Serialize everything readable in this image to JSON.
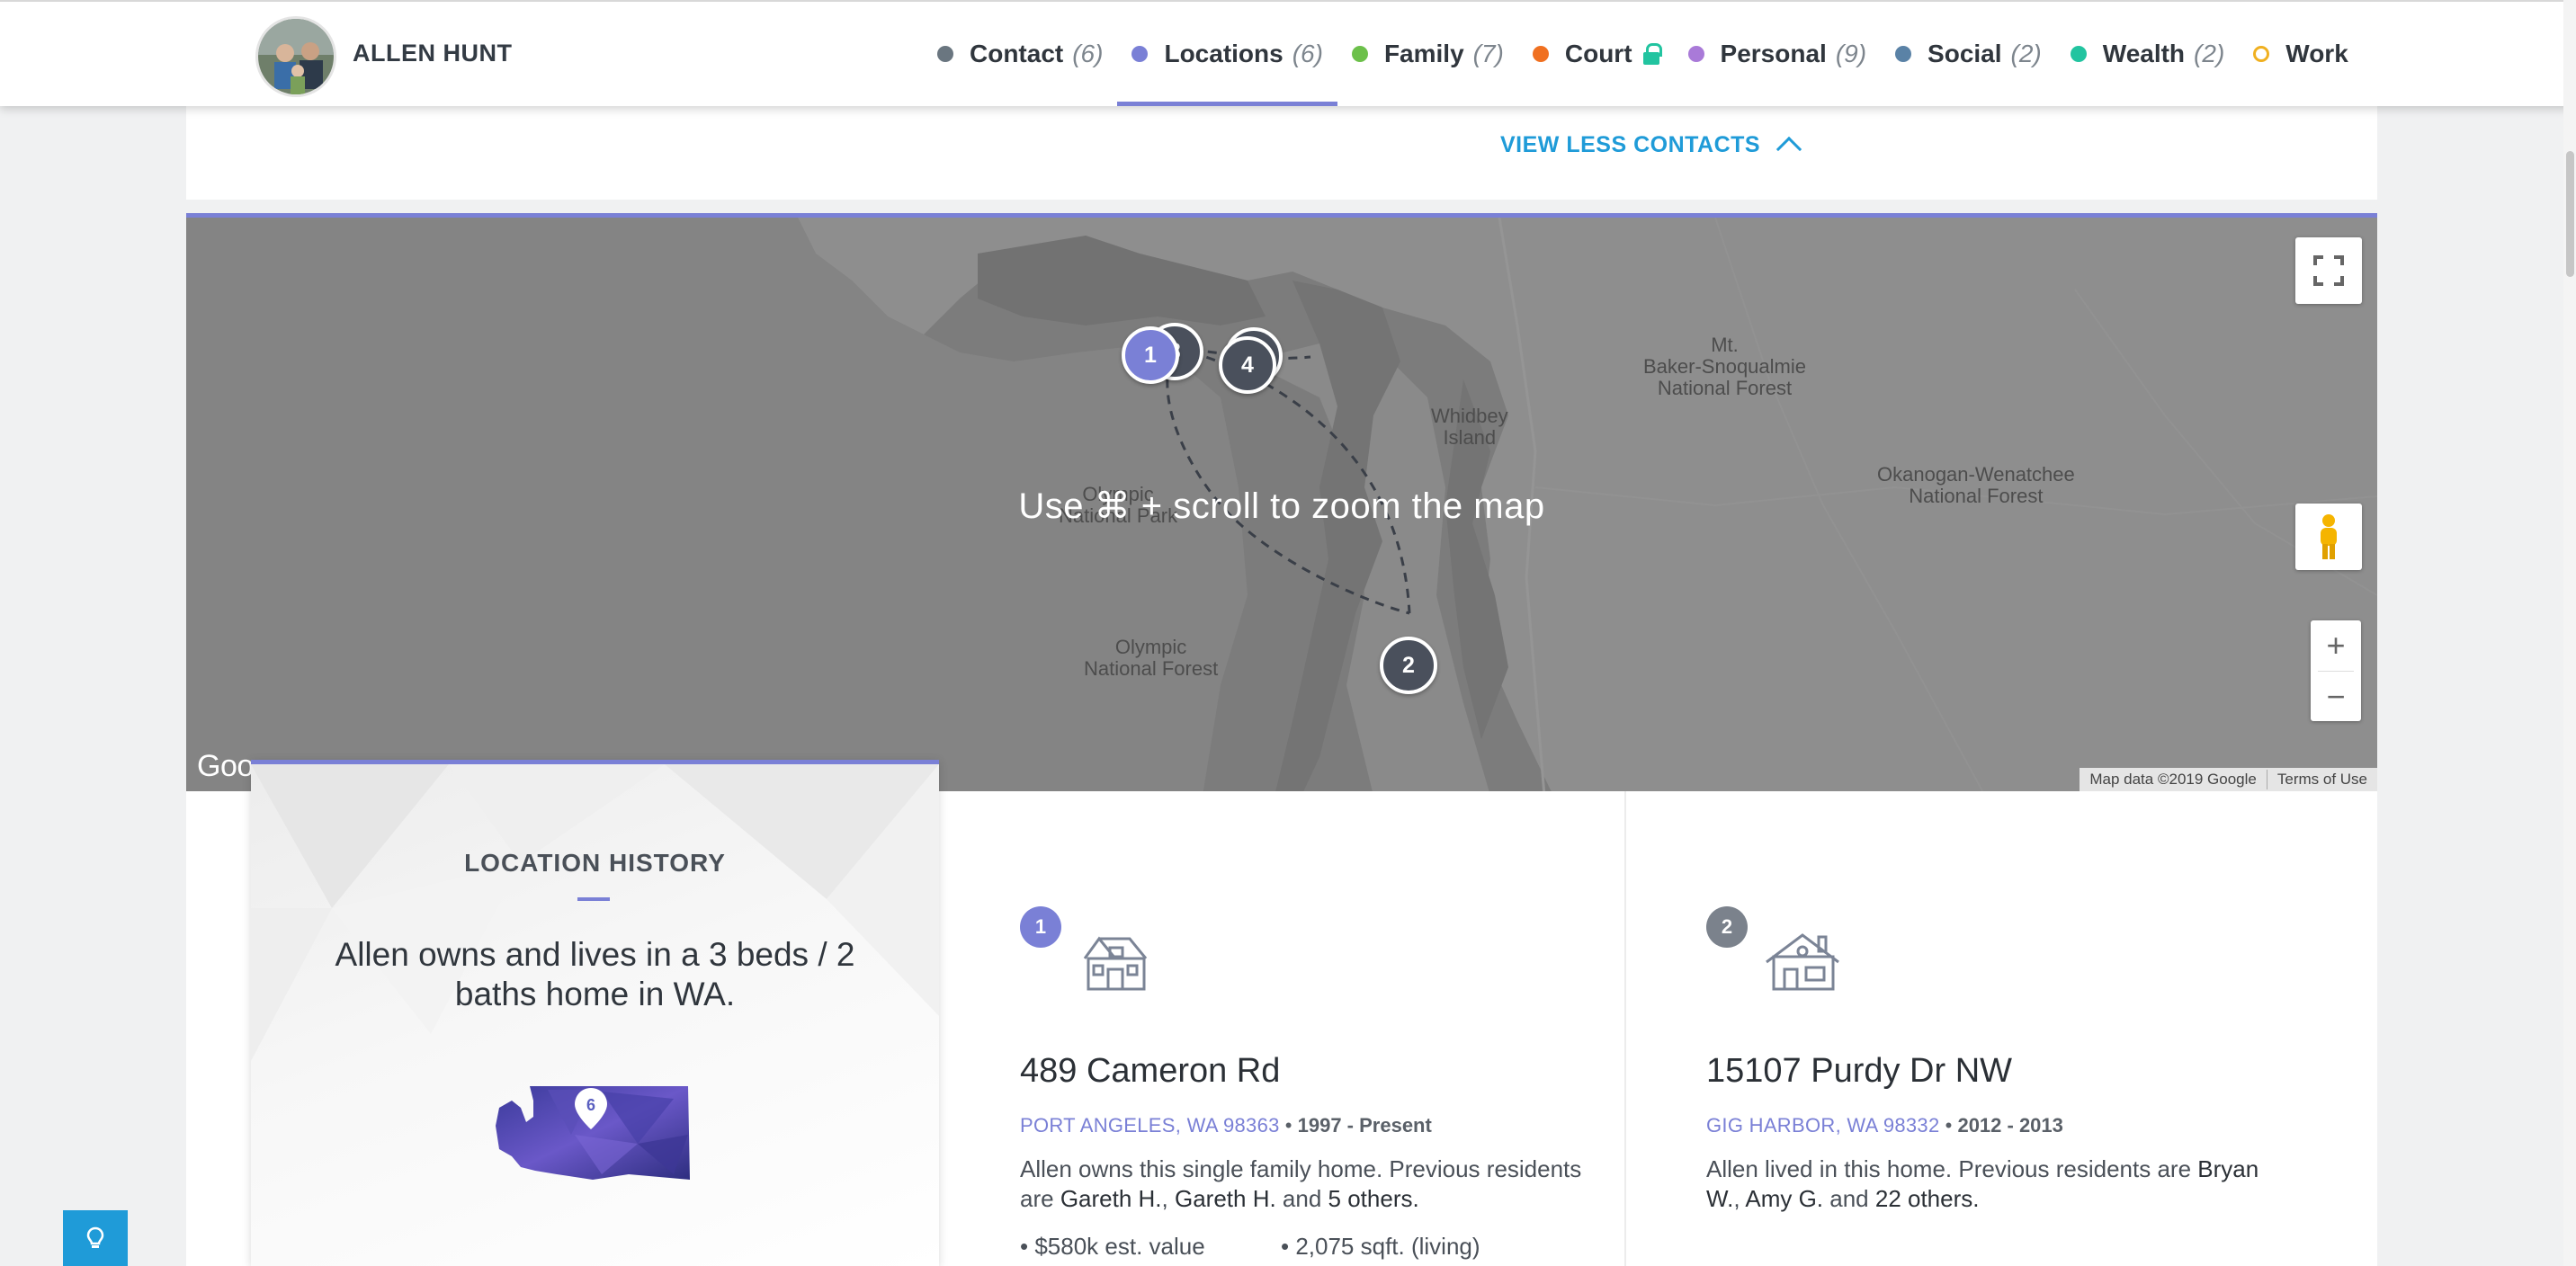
{
  "profile": {
    "name": "ALLEN HUNT"
  },
  "nav": {
    "items": [
      {
        "label": "Contact",
        "count": "(6)",
        "color": "#6a7680"
      },
      {
        "label": "Locations",
        "count": "(6)",
        "color": "#7a80d6",
        "active": true
      },
      {
        "label": "Family",
        "count": "(7)",
        "color": "#6cc04a"
      },
      {
        "label": "Court",
        "count": "",
        "color": "#f07020",
        "locked": true
      },
      {
        "label": "Personal",
        "count": "(9)",
        "color": "#a97ad8"
      },
      {
        "label": "Social",
        "count": "(2)",
        "color": "#5a82a6"
      },
      {
        "label": "Wealth",
        "count": "(2)",
        "color": "#22c4a0"
      },
      {
        "label": "Work",
        "count": "",
        "color": "#f0b020",
        "hollow": true
      }
    ]
  },
  "contacts": {
    "toggle_label": "VIEW LESS CONTACTS"
  },
  "map": {
    "overlay_hint": "Use ⌘ + scroll to zoom the map",
    "labels": {
      "baker": "Mt.\nBaker-Snoqualmie\nNational Forest",
      "whidbey": "Whidbey\nIsland",
      "okanogan": "Okanogan-Wenatchee\nNational Forest",
      "olympic_park": "Olympic\nNational Park",
      "olympic_forest": "Olympic\nNational Forest"
    },
    "markers": [
      "1",
      "3",
      "4",
      "2"
    ],
    "zoom_in": "+",
    "zoom_out": "−",
    "attribution": "Map data ©2019 Google",
    "terms": "Terms of Use",
    "logo": "Goo"
  },
  "history": {
    "title": "LOCATION HISTORY",
    "summary": "Allen owns and lives in a 3 beds / 2 baths home in WA.",
    "state_count": "6"
  },
  "locations": [
    {
      "index": "1",
      "address": "489 Cameron Rd",
      "city": "PORT ANGELES, WA 98363",
      "years": "1997 - Present",
      "desc_prefix": "Allen owns this single family home. Previous residents are ",
      "resident1": "Gareth H.",
      "resident2": "Gareth H.",
      "others": "5 others.",
      "fact1": "$580k est. value",
      "fact2": "2,075 sqft. (living)"
    },
    {
      "index": "2",
      "address": "15107 Purdy Dr NW",
      "city": "GIG HARBOR, WA 98332",
      "years": "2012 - 2013",
      "desc_prefix": "Allen lived in this home. Previous residents are ",
      "resident1": "Bryan W.",
      "resident2": "Amy G.",
      "others": "22 others."
    }
  ]
}
